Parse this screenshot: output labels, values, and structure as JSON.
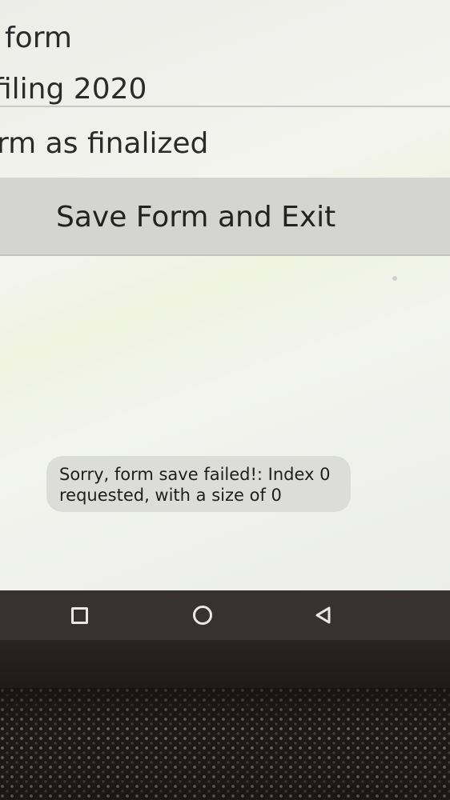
{
  "screen": {
    "lines": [
      "form",
      "filing 2020",
      "rm as finalized"
    ],
    "save_button": {
      "label": "Save Form and Exit"
    },
    "toast": {
      "message": "Sorry, form save failed!: Index 0 requested, with a size of 0"
    }
  },
  "navbar": {
    "icons": {
      "recent": "square-recent-apps-icon",
      "home": "circle-home-icon",
      "back": "triangle-back-icon"
    }
  },
  "colors": {
    "screen_bg": "#f1f2ec",
    "button_bg": "#d4d4d1",
    "toast_bg": "#dcdcd9",
    "navbar_bg": "#37312f",
    "nav_icon": "#e8e8e8"
  }
}
